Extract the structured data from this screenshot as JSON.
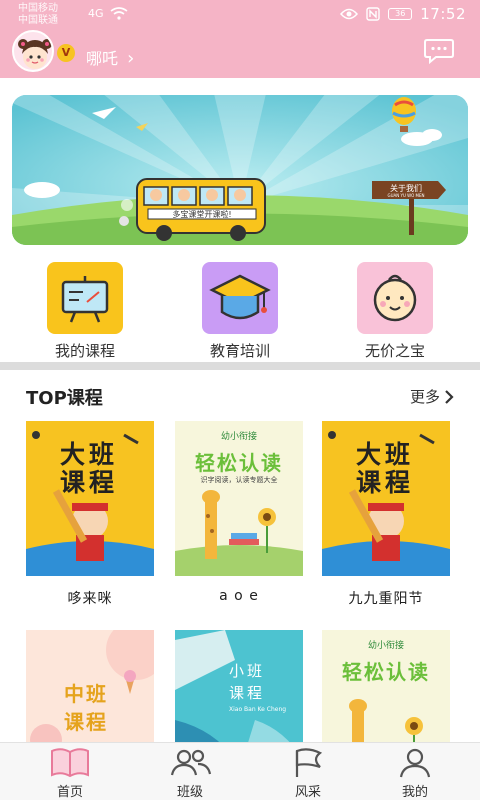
{
  "status_bar": {
    "carrier1": "中国移动",
    "carrier2": "中国联通",
    "net_left": "4G",
    "battery": "36",
    "time": "17:52"
  },
  "header": {
    "vip_badge": "V",
    "username": "哪吒",
    "chevron": "›"
  },
  "banner": {
    "bus_text": "多宝课堂开课啦!",
    "sign_title": "关于我们",
    "sign_sub": "GUAN YU WO MEN"
  },
  "quick_menu": [
    {
      "label": "我的课程",
      "icon": "presentation-board-icon"
    },
    {
      "label": "教育培训",
      "icon": "graduation-cap-icon"
    },
    {
      "label": "无价之宝",
      "icon": "baby-face-icon"
    }
  ],
  "top_courses": {
    "title": "TOP课程",
    "more": "更多",
    "items": [
      {
        "title": "哆来咪",
        "cover_big": "大班",
        "cover_big2": "课程"
      },
      {
        "title": "a o e",
        "cover_small": "幼小衔接",
        "cover_big": "轻松认读",
        "cover_sub": "识字阅读，认读专题大全"
      },
      {
        "title": "九九重阳节",
        "cover_big": "大班",
        "cover_big2": "课程"
      },
      {
        "cover_big": "中班",
        "cover_big2": "课程"
      },
      {
        "cover_big": "小班",
        "cover_big2": "课程",
        "cover_pinyin": "Xiao Ban Ke Cheng"
      },
      {
        "cover_small": "幼小衔接",
        "cover_big": "轻松认读"
      }
    ]
  },
  "bottom_nav": [
    {
      "label": "首页",
      "icon": "book-icon"
    },
    {
      "label": "班级",
      "icon": "class-group-icon"
    },
    {
      "label": "风采",
      "icon": "flag-icon"
    },
    {
      "label": "我的",
      "icon": "person-icon"
    }
  ],
  "colors": {
    "header_pink": "#f5b4c6",
    "accent_yellow": "#f9c41c",
    "accent_purple": "#c99cf5",
    "accent_pink": "#f9c2d8"
  }
}
